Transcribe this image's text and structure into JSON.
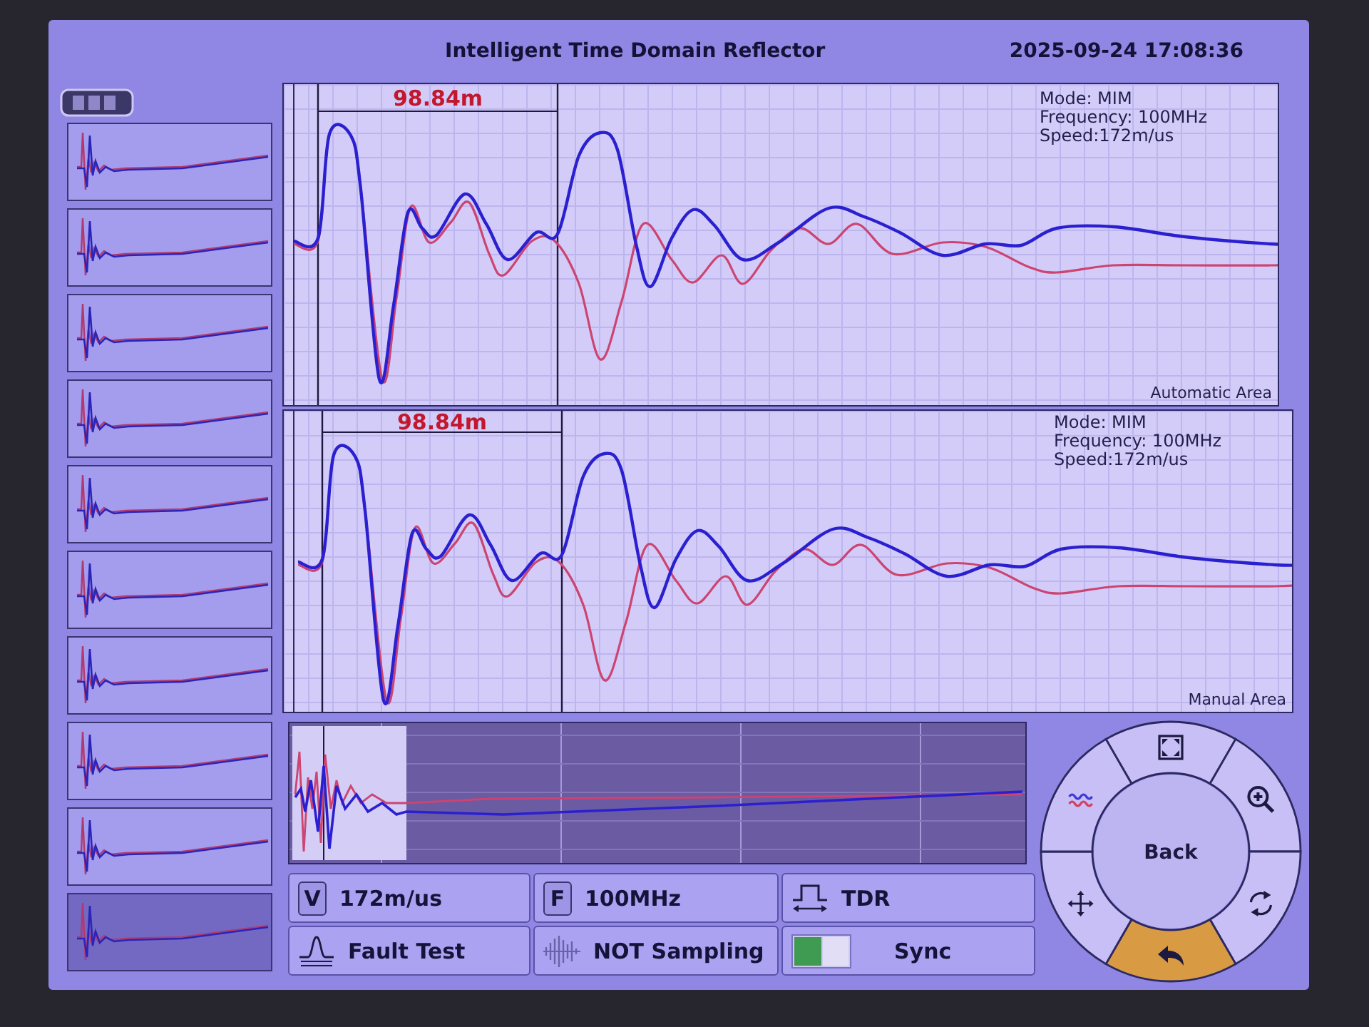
{
  "header": {
    "title": "Intelligent Time Domain Reflector",
    "datetime": "2025-09-24 17:08:36"
  },
  "thumbnails": [
    {
      "selected": false
    },
    {
      "selected": false
    },
    {
      "selected": false
    },
    {
      "selected": false
    },
    {
      "selected": false
    },
    {
      "selected": false
    },
    {
      "selected": false
    },
    {
      "selected": false
    },
    {
      "selected": false
    },
    {
      "selected": true
    }
  ],
  "graphs": [
    {
      "distance": "98.84m",
      "info": [
        "Mode: MIM",
        "Frequency: 100MHz",
        "Speed:172m/us"
      ],
      "area_label": "Automatic Area"
    },
    {
      "distance": "98.84m",
      "info": [
        "Mode: MIM",
        "Frequency: 100MHz",
        "Speed:172m/us"
      ],
      "area_label": "Manual Area"
    }
  ],
  "controls": [
    {
      "kind": "key",
      "key": "V",
      "label": "172m/us"
    },
    {
      "kind": "key",
      "key": "F",
      "label": "100MHz"
    },
    {
      "kind": "pulse",
      "label": "TDR"
    },
    {
      "kind": "peak",
      "label": "Fault Test"
    },
    {
      "kind": "sampling",
      "label": "NOT Sampling"
    },
    {
      "kind": "toggle",
      "label": "Sync",
      "on": true
    }
  ],
  "dial": {
    "center": "Back",
    "items": [
      {
        "kind": "fit",
        "selected": false
      },
      {
        "kind": "zoom",
        "selected": false
      },
      {
        "kind": "rotate",
        "selected": false
      },
      {
        "kind": "back",
        "selected": true
      },
      {
        "kind": "move",
        "selected": false
      },
      {
        "kind": "waves",
        "selected": false
      }
    ]
  }
}
